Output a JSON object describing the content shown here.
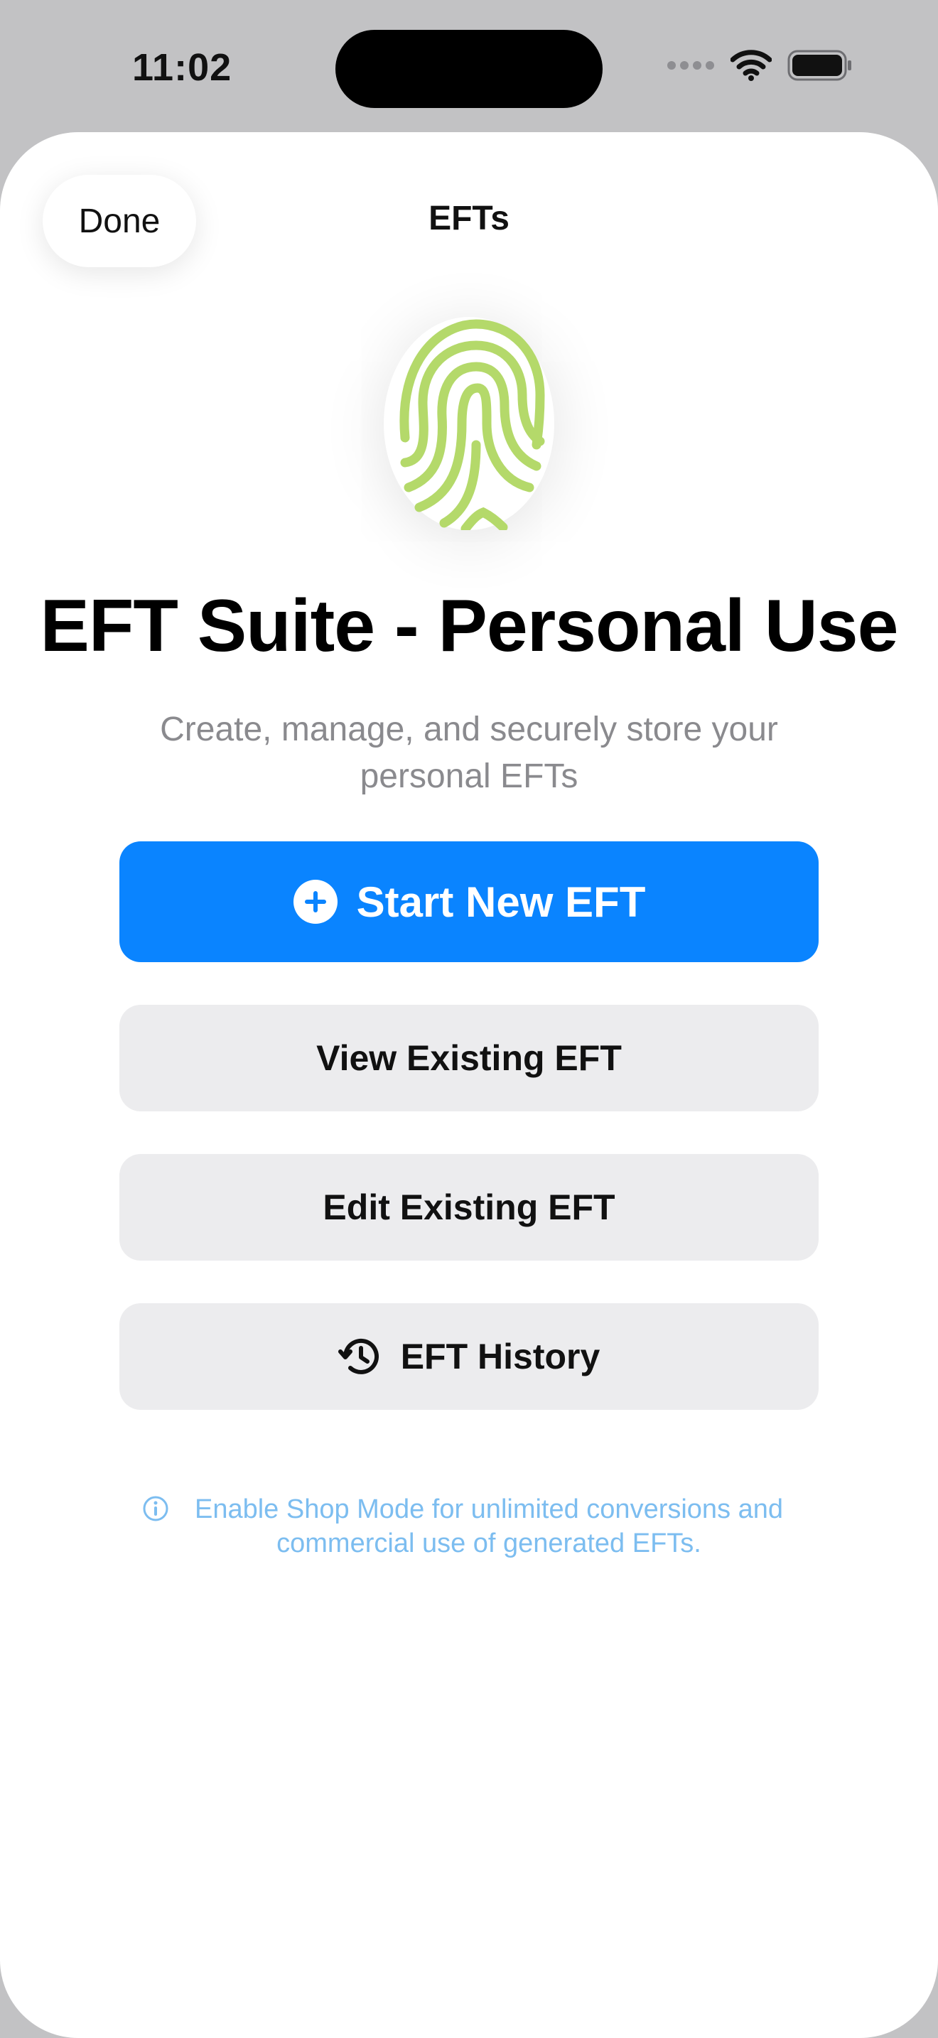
{
  "status_bar": {
    "time": "11:02",
    "icons": [
      "cellular-dots-icon",
      "wifi-icon",
      "battery-icon"
    ]
  },
  "nav": {
    "done_label": "Done",
    "title": "EFTs"
  },
  "hero": {
    "logo_icon": "fingerprint-icon",
    "logo_color": "#b4d96a",
    "headline": "EFT Suite - Personal Use",
    "subtitle": "Create, manage, and securely store your personal EFTs"
  },
  "actions": {
    "start_new": {
      "label": "Start New EFT",
      "icon": "plus-circle-icon",
      "color": "#0a84ff"
    },
    "view_existing": {
      "label": "View Existing EFT"
    },
    "edit_existing": {
      "label": "Edit Existing EFT"
    },
    "history": {
      "label": "EFT History",
      "icon": "history-clock-icon"
    }
  },
  "info": {
    "icon": "info-circle-icon",
    "text": "Enable Shop Mode for unlimited conversions and commercial use of generated EFTs.",
    "color": "#7cbdf0"
  }
}
